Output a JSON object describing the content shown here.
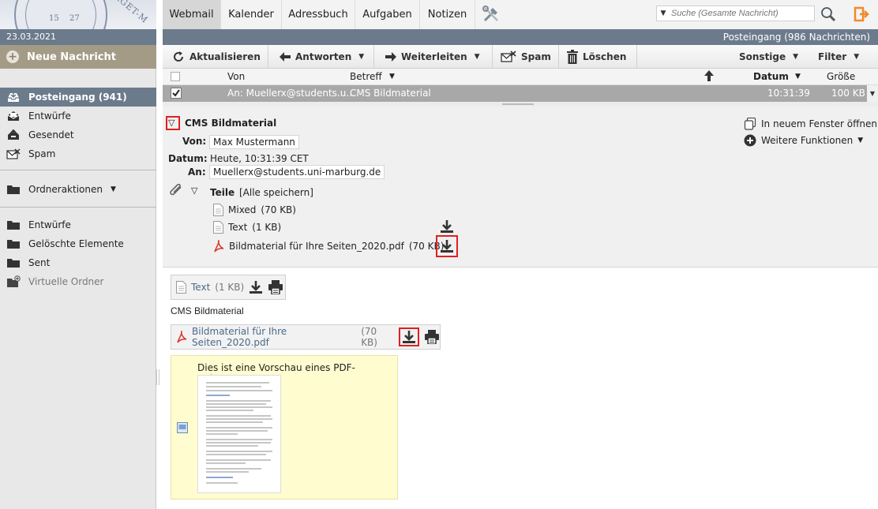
{
  "sidebar": {
    "logo": {
      "seal_left": "15",
      "seal_right": "27",
      "seal_text": "RGET-M"
    },
    "date": "23.03.2021",
    "new_message": "Neue Nachricht",
    "mailboxes": [
      {
        "label": "Posteingang (941)",
        "icon": "inbox-icon",
        "active": true
      },
      {
        "label": "Entwürfe",
        "icon": "drafts-icon"
      },
      {
        "label": "Gesendet",
        "icon": "sent-icon"
      },
      {
        "label": "Spam",
        "icon": "spam-icon"
      }
    ],
    "folder_actions": "Ordneraktionen",
    "folders": [
      {
        "label": "Entwürfe",
        "icon": "folder-icon"
      },
      {
        "label": "Gelöschte Elemente",
        "icon": "folder-icon"
      },
      {
        "label": "Sent",
        "icon": "folder-icon"
      },
      {
        "label": "Virtuelle Ordner",
        "icon": "virtual-folder-icon"
      }
    ]
  },
  "topnav": {
    "tabs": [
      "Webmail",
      "Kalender",
      "Adressbuch",
      "Aufgaben",
      "Notizen"
    ],
    "active_tab": "Webmail",
    "search_placeholder": "Suche (Gesamte Nachricht)"
  },
  "status": "Posteingang (986 Nachrichten)",
  "toolbar": {
    "refresh": "Aktualisieren",
    "reply": "Antworten",
    "forward": "Weiterleiten",
    "spam": "Spam",
    "delete": "Löschen",
    "other": "Sonstige",
    "filter": "Filter"
  },
  "list": {
    "columns": {
      "from": "Von",
      "subject": "Betreff",
      "date": "Datum",
      "size": "Größe"
    },
    "rows": [
      {
        "from": "An: Muellerx@students.u...",
        "subject": "CMS Bildmaterial",
        "date": "10:31:39",
        "size": "100 KB",
        "selected": true
      }
    ]
  },
  "message": {
    "subject": "CMS Bildmaterial",
    "labels": {
      "from": "Von:",
      "date": "Datum:",
      "to": "An:"
    },
    "from": "Max Mustermann",
    "date": "Heute, 10:31:39 CET",
    "to": "Muellerx@students.uni-marburg.de",
    "open_new_window": "In neuem Fenster öffnen",
    "more_functions": "Weitere Funktionen",
    "parts_label": "Teile",
    "save_all": "[Alle speichern]",
    "parts": [
      {
        "name": "Mixed",
        "size": "(70 KB)",
        "icon": "document-icon"
      },
      {
        "name": "Text",
        "size": "(1 KB)",
        "icon": "document-icon"
      },
      {
        "name": "Bildmaterial für Ihre Seiten_2020.pdf",
        "size": "(70 KB)",
        "icon": "pdf-icon"
      }
    ]
  },
  "body": {
    "text_attachment": {
      "name": "Text",
      "size": "(1 KB)"
    },
    "body_text": "CMS Bildmaterial",
    "pdf_attachment": {
      "name": "Bildmaterial für Ihre Seiten_2020.pdf",
      "size": "(70 KB)"
    },
    "preview_text": "Dies ist eine Vorschau eines PDF-Anhangs."
  },
  "colors": {
    "header_bar": "#6b7b8c",
    "new_message_bg": "#a39b85",
    "highlight": "#e02020",
    "selected_row": "#a8a8a8",
    "preview_bg": "#fffccf"
  }
}
